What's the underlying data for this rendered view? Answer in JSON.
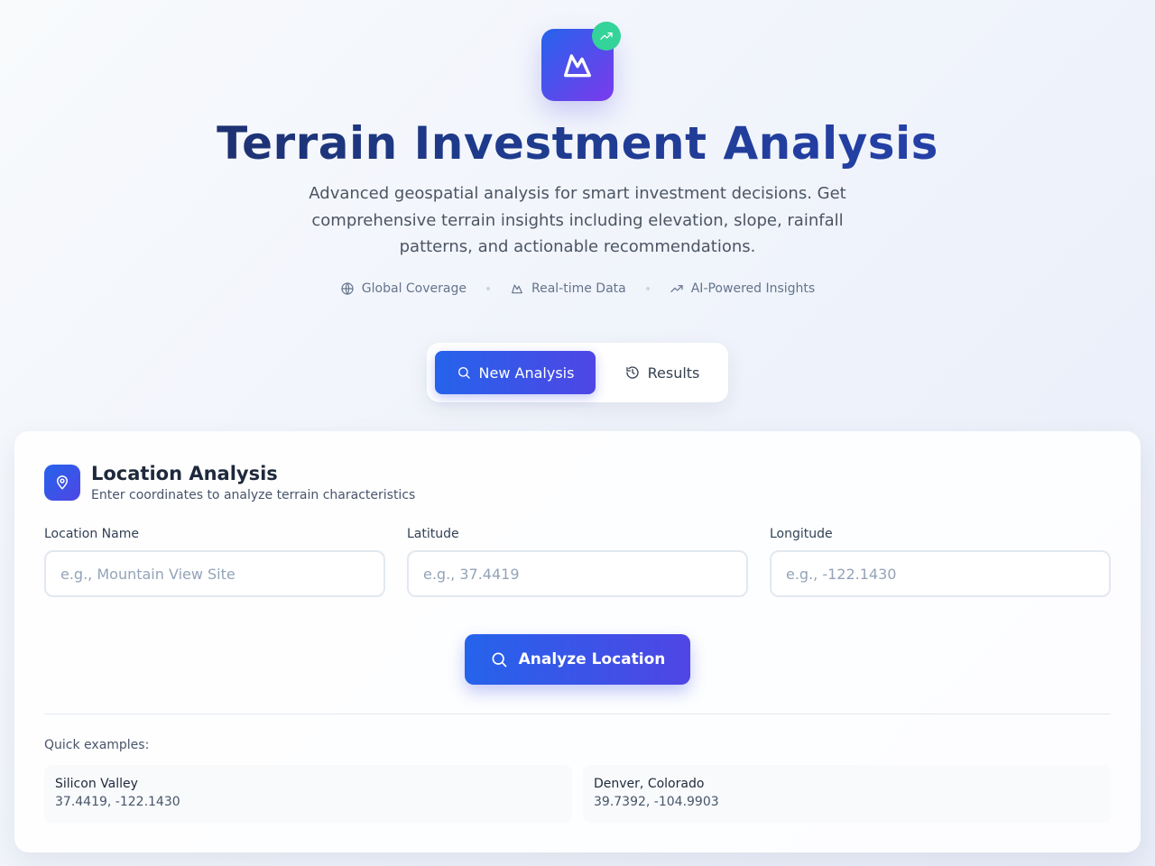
{
  "hero": {
    "title": "Terrain Investment Analysis",
    "subtitle": "Advanced geospatial analysis for smart investment decisions. Get comprehensive terrain insights including elevation, slope, rainfall patterns, and actionable recommendations.",
    "features": [
      {
        "label": "Global Coverage",
        "icon": "globe-icon"
      },
      {
        "label": "Real-time Data",
        "icon": "mountain-icon"
      },
      {
        "label": "AI-Powered Insights",
        "icon": "trending-up-icon"
      }
    ]
  },
  "tabs": [
    {
      "label": "New Analysis",
      "icon": "search-icon",
      "active": true
    },
    {
      "label": "Results",
      "icon": "history-icon",
      "active": false
    }
  ],
  "card": {
    "title": "Location Analysis",
    "subtitle": "Enter coordinates to analyze terrain characteristics",
    "fields": {
      "location": {
        "label": "Location Name",
        "placeholder": "e.g., Mountain View Site",
        "value": ""
      },
      "latitude": {
        "label": "Latitude",
        "placeholder": "e.g., 37.4419",
        "value": ""
      },
      "longitude": {
        "label": "Longitude",
        "placeholder": "e.g., -122.1430",
        "value": ""
      }
    },
    "analyze_label": "Analyze Location",
    "quick_label": "Quick examples:",
    "examples": [
      {
        "name": "Silicon Valley",
        "coords": "37.4419, -122.1430"
      },
      {
        "name": "Denver, Colorado",
        "coords": "39.7392, -104.9903"
      }
    ]
  },
  "colors": {
    "accent": "#2563eb",
    "accent_end": "#4f46e5",
    "badge": "#34d399"
  }
}
